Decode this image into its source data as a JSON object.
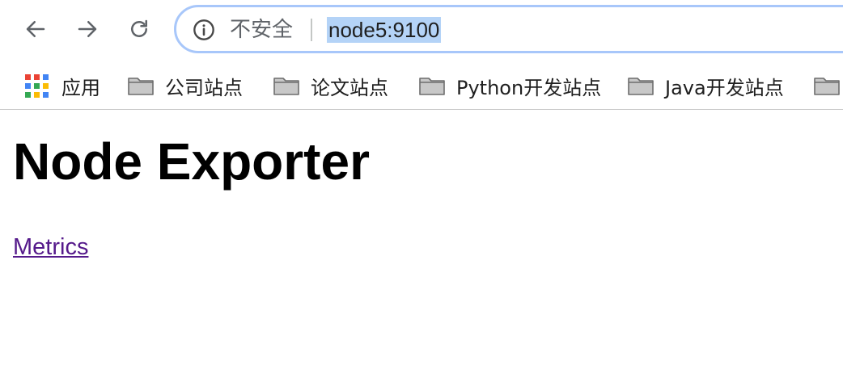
{
  "browser": {
    "omnibox": {
      "security_label": "不安全",
      "url": "node5:9100"
    },
    "bookmarks": [
      {
        "label": "应用",
        "icon": "apps-grid-icon"
      },
      {
        "label": "公司站点",
        "icon": "folder-icon"
      },
      {
        "label": "论文站点",
        "icon": "folder-icon"
      },
      {
        "label": "Python开发站点",
        "icon": "folder-icon"
      },
      {
        "label": "Java开发站点",
        "icon": "folder-icon"
      },
      {
        "label": "",
        "icon": "folder-icon"
      }
    ]
  },
  "page": {
    "title": "Node Exporter",
    "link": "Metrics"
  },
  "colors": {
    "link_visited": "#551a8b",
    "omnibox_border": "#a8c7fa",
    "url_selection": "#b4d3f7"
  }
}
